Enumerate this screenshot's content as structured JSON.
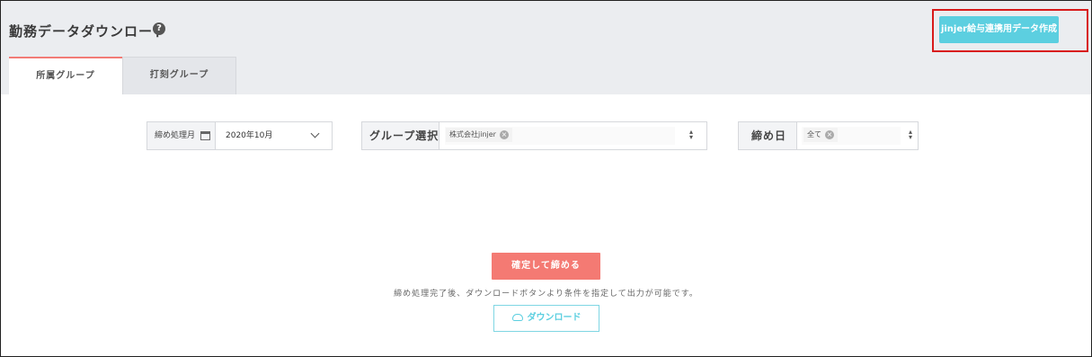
{
  "page": {
    "title": "勤務データダウンロード",
    "help_icon": "?",
    "create_button": "jinjer給与連携用データ作成"
  },
  "tabs": [
    {
      "label": "所属グループ",
      "active": true
    },
    {
      "label": "打刻グループ",
      "active": false
    }
  ],
  "filters": {
    "closing_month": {
      "label": "締め処理月",
      "icon": "calendar-icon",
      "value": "2020年10月"
    },
    "group_select": {
      "label": "グループ選択",
      "selected": "株式会社jinjer",
      "remove": "×"
    },
    "closing_day": {
      "label": "締め日",
      "selected": "全て",
      "remove": "×"
    }
  },
  "actions": {
    "confirm_button": "確定して締める",
    "hint": "締め処理完了後、ダウンロードボタンより条件を指定して出力が可能です。",
    "download_button": "ダウンロード"
  },
  "colors": {
    "accent_cyan": "#5ccfe0",
    "accent_red": "#f47a73",
    "highlight_border": "#d81b1b",
    "header_bg": "#ebedf0"
  }
}
